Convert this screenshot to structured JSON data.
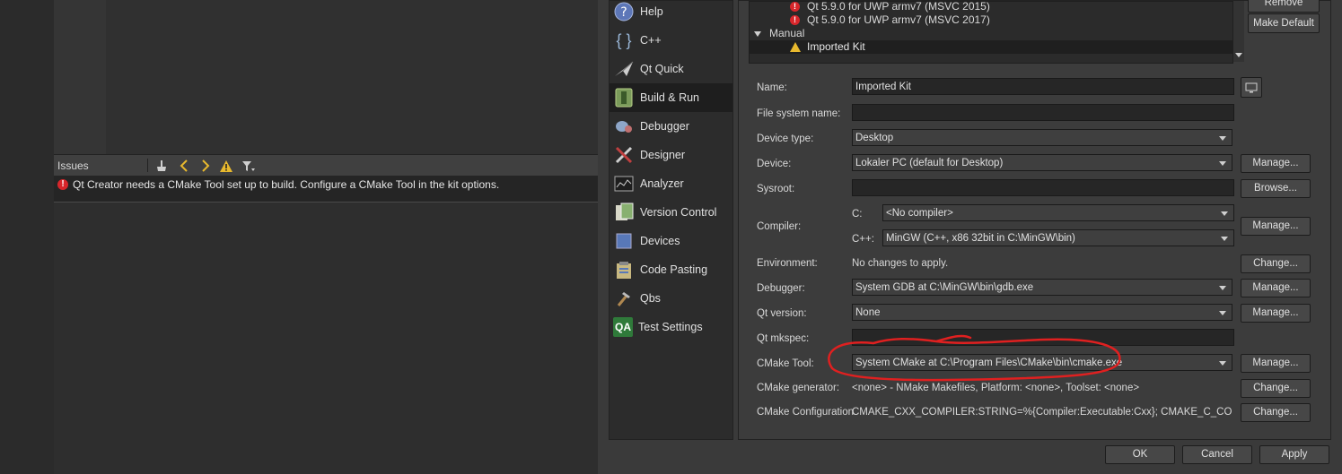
{
  "issues": {
    "title": "Issues",
    "message": "Qt Creator needs a CMake Tool set up to build. Configure a CMake Tool in the kit options.",
    "error_badge": "!"
  },
  "nav": {
    "items": [
      {
        "label": "Help",
        "icon": "help-icon"
      },
      {
        "label": "C++",
        "icon": "cpp-braces-icon"
      },
      {
        "label": "Qt Quick",
        "icon": "paper-plane-icon"
      },
      {
        "label": "Build & Run",
        "icon": "build-run-icon",
        "selected": true
      },
      {
        "label": "Debugger",
        "icon": "bug-icon"
      },
      {
        "label": "Designer",
        "icon": "designer-tools-icon"
      },
      {
        "label": "Analyzer",
        "icon": "analyzer-chart-icon"
      },
      {
        "label": "Version Control",
        "icon": "version-control-icon"
      },
      {
        "label": "Devices",
        "icon": "devices-icon"
      },
      {
        "label": "Code Pasting",
        "icon": "code-pasting-icon"
      },
      {
        "label": "Qbs",
        "icon": "hammer-icon"
      },
      {
        "label": "Test Settings",
        "icon": "qa-icon"
      }
    ],
    "qa_badge": "QA"
  },
  "kits": {
    "rows": [
      {
        "label": "Qt 5.9.0 for UWP armv7 (MSVC 2015)",
        "status": "error"
      },
      {
        "label": "Qt 5.9.0 for UWP armv7 (MSVC 2017)",
        "status": "error"
      }
    ],
    "group": "Manual",
    "selected": "Imported Kit",
    "side_buttons": {
      "remove": "Remove",
      "make_default": "Make Default"
    }
  },
  "form": {
    "name_label": "Name:",
    "name_value": "Imported Kit",
    "fs_label": "File system name:",
    "fs_value": "",
    "device_type_label": "Device type:",
    "device_type_value": "Desktop",
    "device_label": "Device:",
    "device_value": "Lokaler PC (default for Desktop)",
    "sysroot_label": "Sysroot:",
    "sysroot_value": "",
    "compiler_label": "Compiler:",
    "compiler_c_label": "C:",
    "compiler_c_value": "<No compiler>",
    "compiler_cpp_label": "C++:",
    "compiler_cpp_value": "MinGW (C++, x86 32bit in C:\\MinGW\\bin)",
    "environment_label": "Environment:",
    "environment_value": "No changes to apply.",
    "debugger_label": "Debugger:",
    "debugger_value": "System GDB at C:\\MinGW\\bin\\gdb.exe",
    "qt_version_label": "Qt version:",
    "qt_version_value": "None",
    "mkspec_label": "Qt mkspec:",
    "mkspec_value": "",
    "cmake_tool_label": "CMake Tool:",
    "cmake_tool_value": "System CMake at C:\\Program Files\\CMake\\bin\\cmake.exe",
    "cmake_gen_label": "CMake generator:",
    "cmake_gen_value": "<none> - NMake Makefiles, Platform: <none>, Toolset: <none>",
    "cmake_conf_label": "CMake Configuration",
    "cmake_conf_value": "CMAKE_CXX_COMPILER:STRING=%{Compiler:Executable:Cxx}; CMAKE_C_COMPILE..."
  },
  "buttons": {
    "manage": "Manage...",
    "browse": "Browse...",
    "change": "Change...",
    "ok": "OK",
    "cancel": "Cancel",
    "apply": "Apply"
  },
  "colors": {
    "error": "#d8262b",
    "warning": "#e8b92e",
    "annotation_red": "#e02020"
  }
}
